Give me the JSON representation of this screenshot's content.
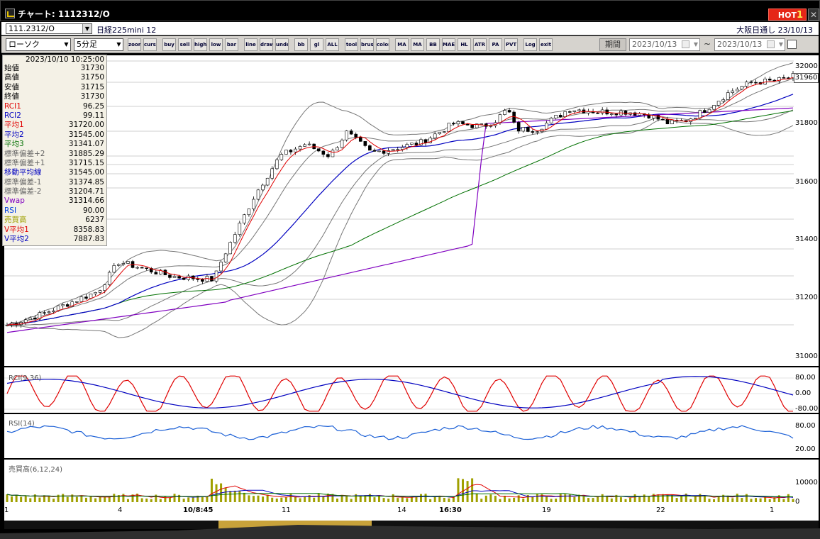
{
  "window": {
    "title": "チャート: 1112312/O",
    "hot_label": "HOT",
    "hot_num": "1",
    "close": "✕"
  },
  "symbol": {
    "code": "111.2312/O",
    "name": "日経225mini 12",
    "exchange": "大阪日通し  23/10/13"
  },
  "toolbar": {
    "chart_type": "ローソク",
    "interval": "5分足",
    "buttons": [
      "zoom",
      "cursor",
      "sep",
      "buy",
      "sell",
      "high",
      "low",
      "bar",
      "sep",
      "line",
      "draw",
      "undo",
      "sep",
      "bb",
      "gl",
      "ALL",
      "sep",
      "tool",
      "brush",
      "color",
      "sep",
      "MA MA",
      "MA",
      "BB",
      "MAE",
      "HL",
      "ATR",
      "PA PA",
      "PVT",
      "sep",
      "Log",
      "exit"
    ],
    "period_label": "期間",
    "date_from": "2023/10/13",
    "date_to": "2023/10/13",
    "tilde": "~"
  },
  "info": {
    "datetime": "2023/10/10  10:25:00",
    "rows": [
      {
        "label": "始値",
        "value": "31730",
        "color": "#000000"
      },
      {
        "label": "高値",
        "value": "31750",
        "color": "#000000"
      },
      {
        "label": "安値",
        "value": "31715",
        "color": "#000000"
      },
      {
        "label": "終値",
        "value": "31730",
        "color": "#000000"
      },
      {
        "label": "RCI1",
        "value": "96.25",
        "color": "#e00000"
      },
      {
        "label": "RCI2",
        "value": "99.11",
        "color": "#0000c0"
      },
      {
        "label": "平均1",
        "value": "31720.00",
        "color": "#e00000"
      },
      {
        "label": "平均2",
        "value": "31545.00",
        "color": "#0000c0"
      },
      {
        "label": "平均3",
        "value": "31341.07",
        "color": "#007000"
      },
      {
        "label": "標準偏差+2",
        "value": "31885.29",
        "color": "#666666"
      },
      {
        "label": "標準偏差+1",
        "value": "31715.15",
        "color": "#666666"
      },
      {
        "label": "移動平均線",
        "value": "31545.00",
        "color": "#0000c0"
      },
      {
        "label": "標準偏差-1",
        "value": "31374.85",
        "color": "#666666"
      },
      {
        "label": "標準偏差-2",
        "value": "31204.71",
        "color": "#666666"
      },
      {
        "label": "Vwap",
        "value": "31314.66",
        "color": "#8000c0"
      },
      {
        "label": "RSI",
        "value": "90.00",
        "color": "#0040e0"
      },
      {
        "label": "売買高",
        "value": "6237",
        "color": "#a0a000"
      },
      {
        "label": "V平均1",
        "value": "8358.83",
        "color": "#e00000"
      },
      {
        "label": "V平均2",
        "value": "7887.83",
        "color": "#0000c0"
      }
    ]
  },
  "price_axis": {
    "last_price": "31960",
    "labels": [
      "32000",
      "31800",
      "31600",
      "31400",
      "31200",
      "31000"
    ]
  },
  "rci_panel": {
    "label": "RCI(9,36)",
    "axis": [
      "80.00",
      "0.00",
      "-80.00"
    ]
  },
  "rsi_panel": {
    "label": "RSI(14)",
    "axis": [
      "80.00",
      "20.00"
    ]
  },
  "volume_panel": {
    "label": "売買高(6,12,24)",
    "axis": [
      "10000",
      "0"
    ]
  },
  "x_axis": [
    {
      "label": "1",
      "bold": false
    },
    {
      "label": "4",
      "bold": false
    },
    {
      "label": "10/8:45",
      "bold": true
    },
    {
      "label": "11",
      "bold": false
    },
    {
      "label": "14",
      "bold": false
    },
    {
      "label": "16:30",
      "bold": true
    },
    {
      "label": "19",
      "bold": false
    },
    {
      "label": "22",
      "bold": false
    },
    {
      "label": "1",
      "bold": false
    }
  ],
  "colors": {
    "up_candle": "#ffffff",
    "down_candle": "#000000",
    "ma1": "#e00000",
    "ma2": "#0000c0",
    "ma3": "#007000",
    "bands": "#777777",
    "vwap": "#8000c0",
    "rsi": "#1a5fd6",
    "volume": "#a0a000"
  }
}
